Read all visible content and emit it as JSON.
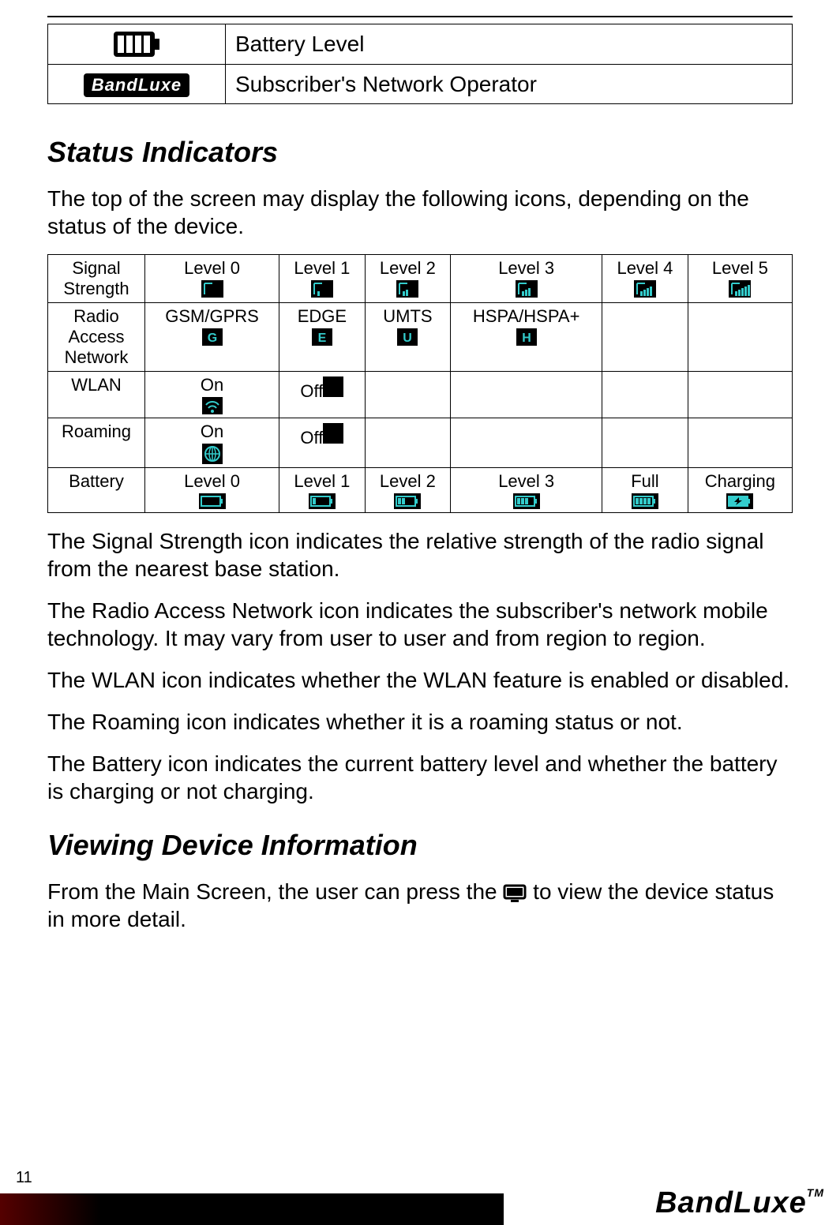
{
  "top_table": {
    "row1_label": "Battery Level",
    "row2_label": "Subscriber's Network Operator",
    "row2_badge": "BandLuxe"
  },
  "section1": {
    "title": "Status Indicators",
    "intro": "The top of the screen may display the following icons, depending on the status of the device."
  },
  "status_table": {
    "rows": [
      {
        "hdr": "Signal Strength",
        "cells": [
          "Level 0",
          "Level 1",
          "Level 2",
          "Level 3",
          "Level 4",
          "Level 5"
        ]
      },
      {
        "hdr": "Radio Access Network",
        "cells": [
          "GSM/GPRS",
          "EDGE",
          "UMTS",
          "HSPA/HSPA+",
          "",
          ""
        ]
      },
      {
        "hdr": "WLAN",
        "cells": [
          "On",
          "Off",
          "",
          "",
          "",
          ""
        ]
      },
      {
        "hdr": "Roaming",
        "cells": [
          "On",
          "Off",
          "",
          "",
          "",
          ""
        ]
      },
      {
        "hdr": "Battery",
        "cells": [
          "Level 0",
          "Level 1",
          "Level 2",
          "Level 3",
          "Full",
          "Charging"
        ]
      }
    ]
  },
  "paragraphs": {
    "p1": "The Signal Strength icon indicates the relative strength of the radio signal from the nearest base station.",
    "p2": "The Radio Access Network icon indicates the subscriber's network mobile technology. It may vary from user to user and from region to region.",
    "p3": "The WLAN icon indicates whether the WLAN feature is enabled or disabled.",
    "p4": "The Roaming icon indicates whether it is a roaming status or not.",
    "p5": "The Battery icon indicates the current battery level and whether the battery is charging or not charging."
  },
  "section2": {
    "title": "Viewing Device Information",
    "text_before": "From the Main Screen, the user can press the ",
    "text_after": " to view the device status in more detail."
  },
  "footer": {
    "page_number": "11",
    "brand": "BandLuxe",
    "tm": "TM"
  }
}
